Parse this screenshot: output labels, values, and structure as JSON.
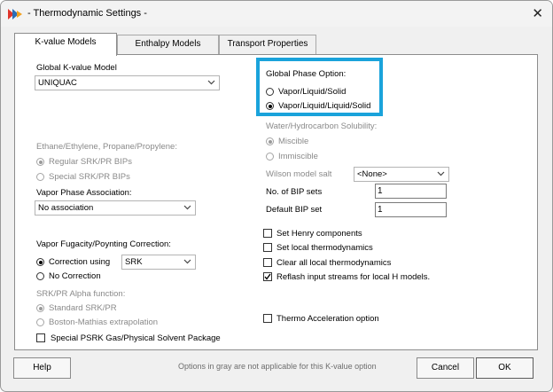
{
  "window": {
    "title": "- Thermodynamic Settings -",
    "close_glyph": "✕"
  },
  "tabs": [
    {
      "label": "K-value Models"
    },
    {
      "label": "Enthalpy Models"
    },
    {
      "label": "Transport Properties"
    }
  ],
  "left": {
    "global_k_label": "Global K-value Model",
    "global_k_value": "UNIQUAC",
    "ethane_label": "Ethane/Ethylene, Propane/Propylene:",
    "regular_bips": "Regular SRK/PR BIPs",
    "special_bips": "Special SRK/PR BIPs",
    "vapor_assoc_label": "Vapor Phase Association:",
    "vapor_assoc_value": "No association",
    "fugacity_label": "Vapor Fugacity/Poynting Correction:",
    "correction_using": "Correction using",
    "correction_method": "SRK",
    "no_correction": "No Correction",
    "alpha_label": "SRK/PR Alpha function:",
    "standard_alpha": "Standard SRK/PR",
    "boston_mathias": "Boston-Mathias extrapolation",
    "psrk_label": "Special PSRK Gas/Physical Solvent Package"
  },
  "right": {
    "phase_option_label": "Global Phase Option:",
    "vle": "Vapor/Liquid/Solid",
    "vlle": "Vapor/Liquid/Liquid/Solid",
    "water_label": "Water/Hydrocarbon Solubility:",
    "miscible": "Miscible",
    "immiscible": "Immiscible",
    "wilson_label": "Wilson model salt",
    "wilson_value": "<None>",
    "bip_sets_label": "No. of BIP sets",
    "bip_sets_value": "1",
    "default_bip_label": "Default BIP set",
    "default_bip_value": "1",
    "henry": "Set Henry components",
    "local_thermo": "Set local thermodynamics",
    "clear_local": "Clear all local thermodynamics",
    "reflash": "Reflash input streams for local H models.",
    "accel": "Thermo Acceleration option"
  },
  "footer": {
    "help": "Help",
    "note": "Options in gray are not applicable for this K-value option",
    "cancel": "Cancel",
    "ok": "OK"
  },
  "state": {
    "selected_phase_option": "Vapor/Liquid/Liquid/Solid",
    "reflash_checked": true,
    "highlight_color": "#1aa3db"
  }
}
